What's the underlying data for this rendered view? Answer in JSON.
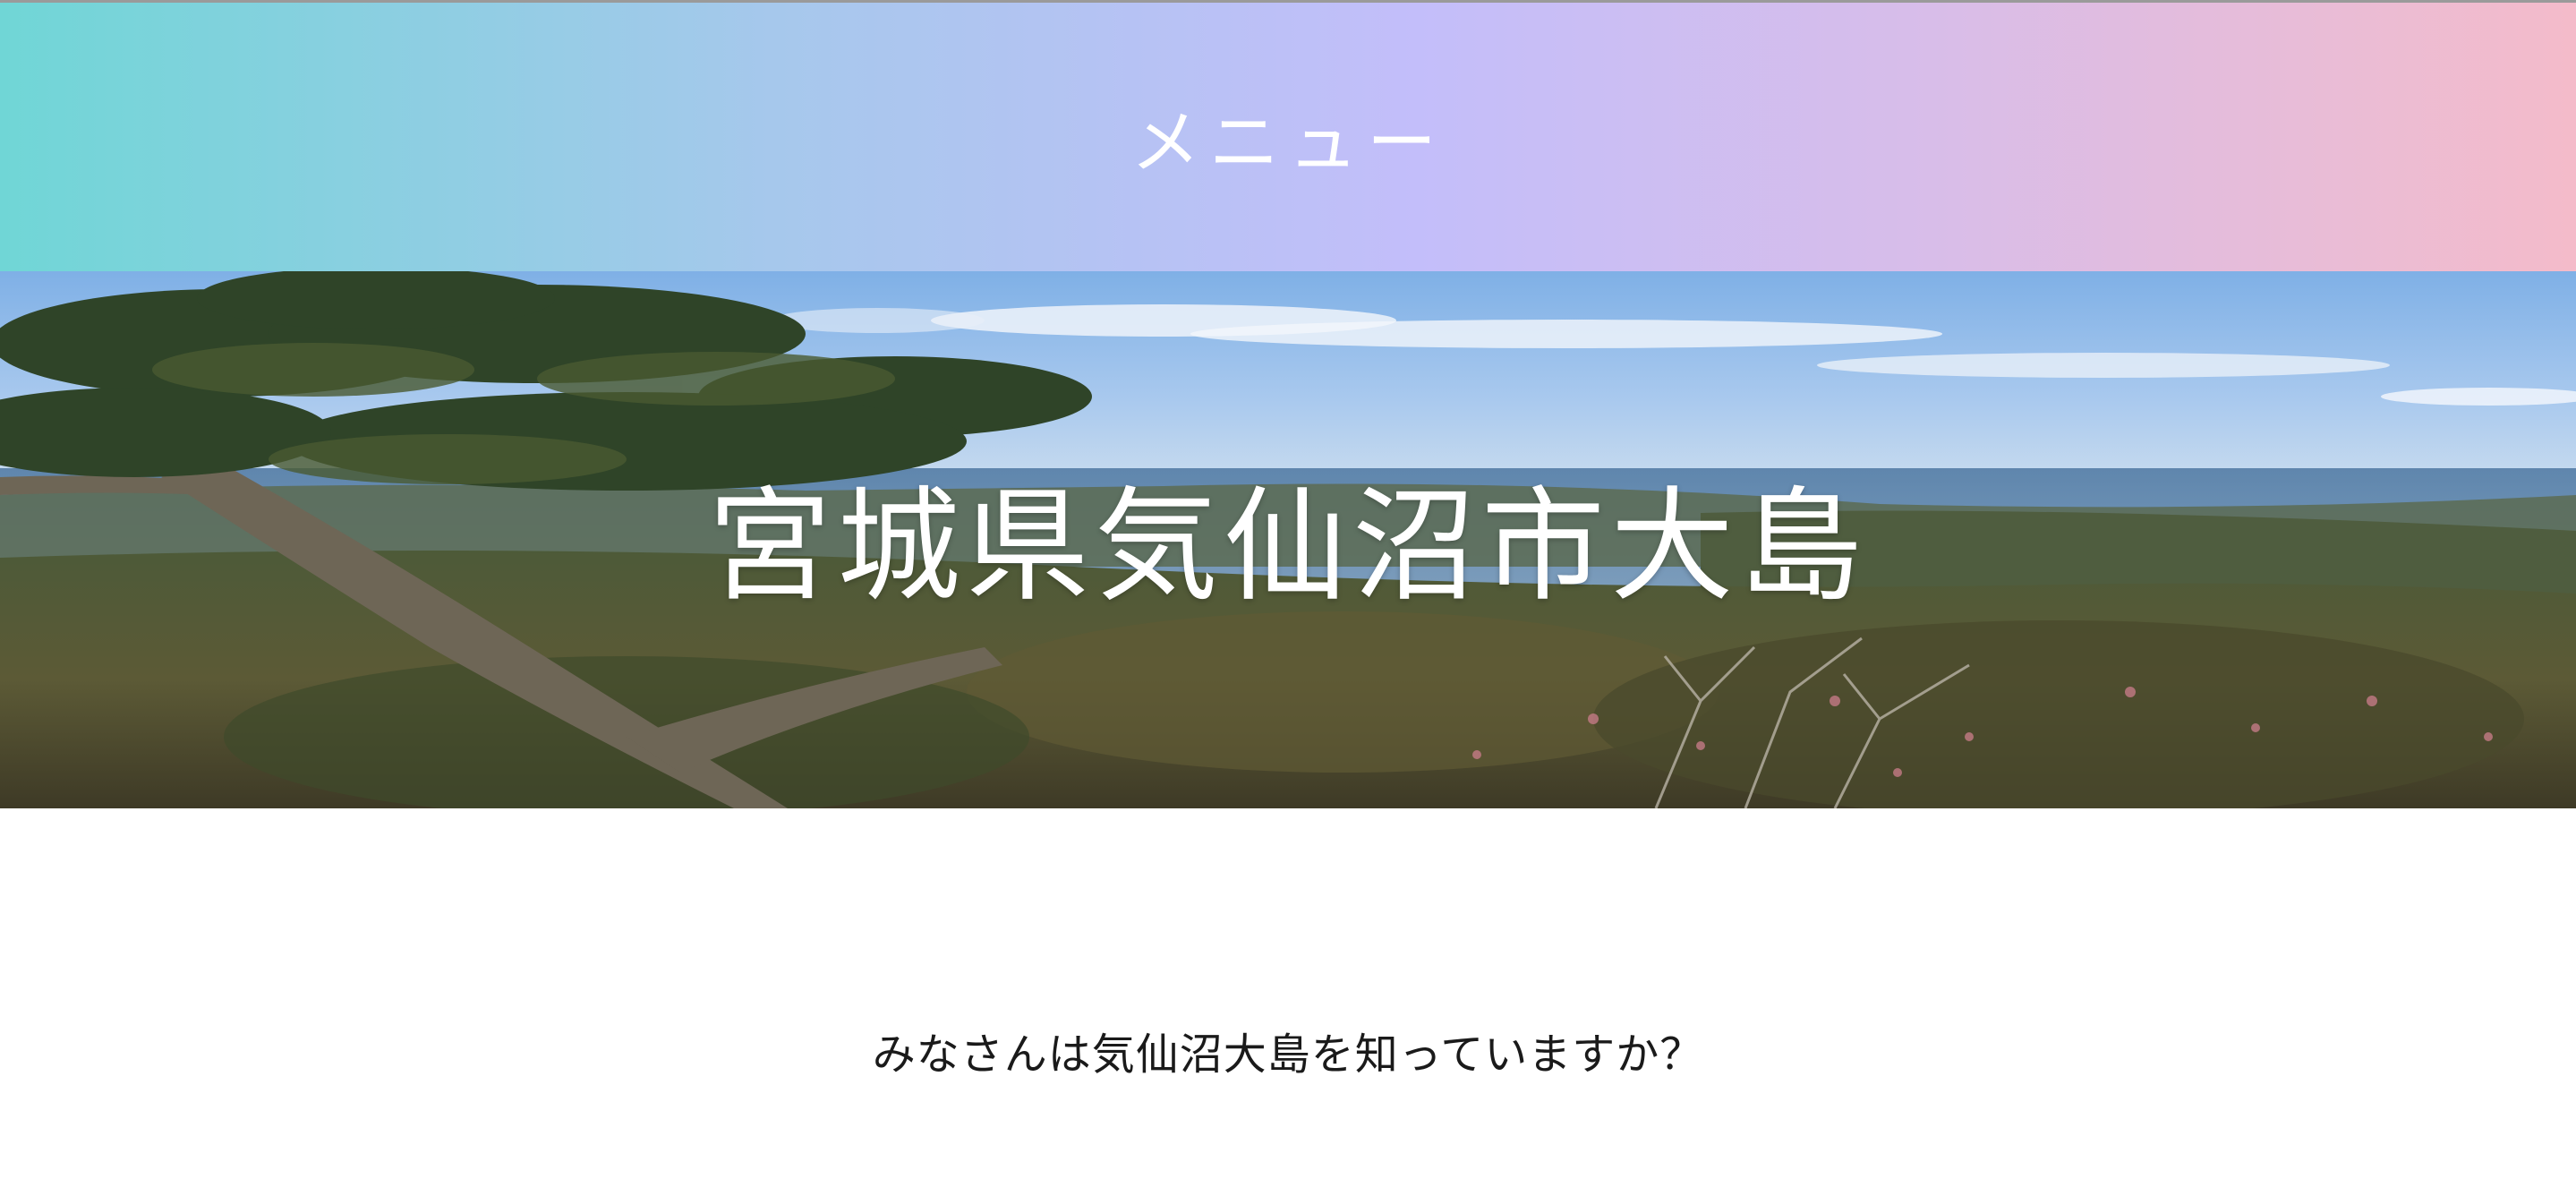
{
  "header": {
    "menu_label": "メニュー"
  },
  "hero": {
    "title": "宮城県気仙沼市大島",
    "image_description_icon": "landscape-photo"
  },
  "main": {
    "intro_text": "みなさんは気仙沼大島を知っていますか？"
  },
  "colors": {
    "menu_gradient_start": "#70d6d6",
    "menu_gradient_mid": "#c3befa",
    "menu_gradient_end": "#f4bbca",
    "hero_title": "#ffffff",
    "body_text": "#1a1a1a"
  }
}
